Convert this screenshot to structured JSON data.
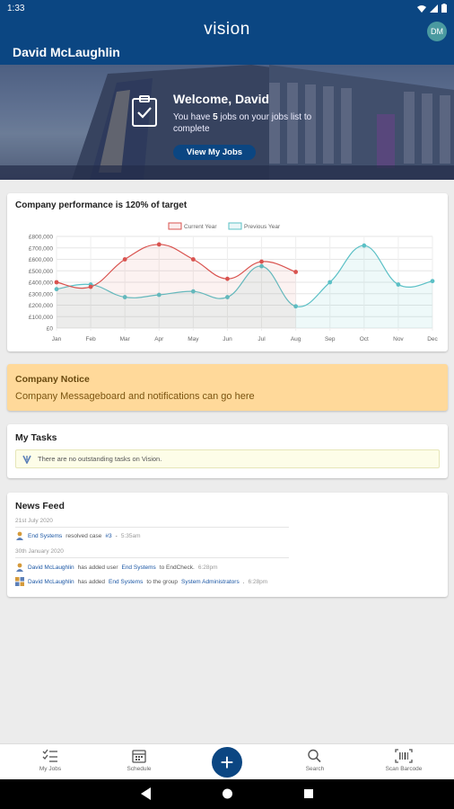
{
  "status": {
    "time": "1:33"
  },
  "app": {
    "brand": "vision",
    "user_name": "David McLaughlin",
    "avatar_initials": "DM",
    "accent": "#0b4682"
  },
  "hero": {
    "welcome": "Welcome, David",
    "jobs_prefix": "You have ",
    "jobs_count": "5",
    "jobs_suffix": " jobs on your jobs list to complete",
    "button_label": "View My Jobs"
  },
  "performance": {
    "title": "Company performance is 120% of target",
    "legend_current": "Current Year",
    "legend_previous": "Previous Year"
  },
  "chart_data": {
    "type": "line",
    "categories": [
      "Jan",
      "Feb",
      "Mar",
      "Apr",
      "May",
      "Jun",
      "Jul",
      "Aug",
      "Sep",
      "Oct",
      "Nov",
      "Dec"
    ],
    "y_ticks": [
      "£800,000",
      "£700,000",
      "£600,000",
      "£500,000",
      "£400,000",
      "£300,000",
      "£200,000",
      "£100,000",
      "£0"
    ],
    "ylim": [
      0,
      800000
    ],
    "grid": true,
    "legend_position": "top",
    "series": [
      {
        "name": "Current Year",
        "color": "#d9534f",
        "fill": "rgba(217,83,79,0.08)",
        "values": [
          400000,
          360000,
          600000,
          730000,
          600000,
          430000,
          580000,
          490000
        ]
      },
      {
        "name": "Previous Year",
        "color": "#5bc0c6",
        "fill": "rgba(91,192,198,0.10)",
        "values": [
          340000,
          380000,
          270000,
          290000,
          320000,
          270000,
          540000,
          190000,
          400000,
          720000,
          380000,
          410000
        ]
      }
    ]
  },
  "notice": {
    "title": "Company Notice",
    "body": "Company Messageboard and notifications can go here"
  },
  "tasks": {
    "title": "My Tasks",
    "empty_message": "There are no outstanding tasks on Vision."
  },
  "news": {
    "title": "News Feed",
    "groups": [
      {
        "date": "21st July 2020",
        "items": [
          {
            "actor": "End Systems",
            "text1": " resolved case ",
            "link1": "#3",
            "text2": " - ",
            "time": "5:35am"
          }
        ]
      },
      {
        "date": "30th January 2020",
        "items": [
          {
            "actor": "David McLaughlin",
            "text1": " has added user ",
            "link1": "End Systems",
            "text2": " to EndCheck.",
            "time": "6:28pm"
          },
          {
            "actor": "David McLaughlin",
            "text1": " has added ",
            "link1": "End Systems",
            "text2": " to the group ",
            "link2": "System Administrators",
            "text3": ".",
            "time": "6:28pm"
          }
        ]
      }
    ]
  },
  "bottom_nav": {
    "my_jobs": "My Jobs",
    "schedule": "Schedule",
    "add": "+",
    "search": "Search",
    "scan": "Scan Barcode"
  }
}
